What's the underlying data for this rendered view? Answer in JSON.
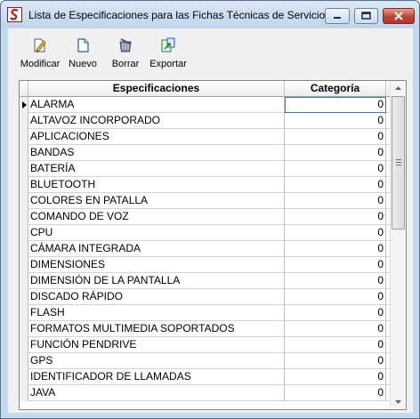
{
  "window": {
    "title": "Lista de Especificaciones para las Fichas Técnicas de Servicios"
  },
  "toolbar": {
    "modify_label": "Modificar",
    "new_label": "Nuevo",
    "delete_label": "Borrar",
    "export_label": "Exportar"
  },
  "grid": {
    "columns": [
      "Especificaciones",
      "Categoría"
    ],
    "rows": [
      {
        "spec": "ALARMA",
        "cat": "0"
      },
      {
        "spec": "ALTAVOZ INCORPORADO",
        "cat": "0"
      },
      {
        "spec": "APLICACIONES",
        "cat": "0"
      },
      {
        "spec": "BANDAS",
        "cat": "0"
      },
      {
        "spec": "BATERÍA",
        "cat": "0"
      },
      {
        "spec": "BLUETOOTH",
        "cat": "0"
      },
      {
        "spec": "COLORES EN PATALLA",
        "cat": "0"
      },
      {
        "spec": "COMANDO DE VOZ",
        "cat": "0"
      },
      {
        "spec": "CPU",
        "cat": "0"
      },
      {
        "spec": "CÁMARA INTEGRADA",
        "cat": "0"
      },
      {
        "spec": "DIMENSIONES",
        "cat": "0"
      },
      {
        "spec": "DIMENSIÓN DE LA PANTALLA",
        "cat": "0"
      },
      {
        "spec": "DISCADO RÁPIDO",
        "cat": "0"
      },
      {
        "spec": "FLASH",
        "cat": "0"
      },
      {
        "spec": "FORMATOS MULTIMEDIA SOPORTADOS",
        "cat": "0"
      },
      {
        "spec": "FUNCIÓN PENDRIVE",
        "cat": "0"
      },
      {
        "spec": "GPS",
        "cat": "0"
      },
      {
        "spec": "IDENTIFICADOR DE LLAMADAS",
        "cat": "0"
      },
      {
        "spec": "JAVA",
        "cat": "0"
      }
    ]
  }
}
